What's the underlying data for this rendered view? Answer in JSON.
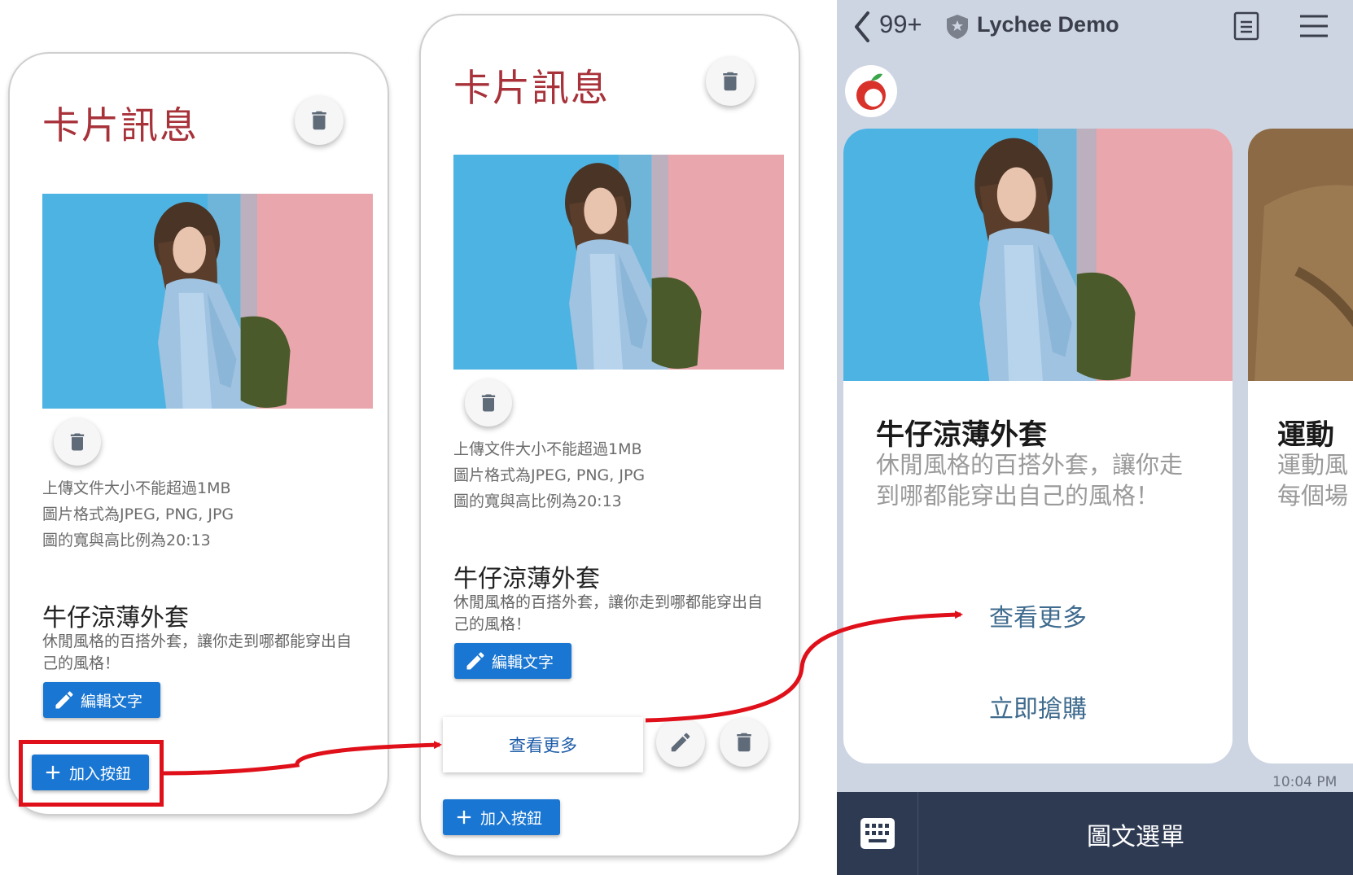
{
  "editor": {
    "card_title": "卡片訊息",
    "upload_info": [
      "上傳文件大小不能超過1MB",
      "圖片格式為JPEG, PNG, JPG",
      "圖的寬與高比例為20:13"
    ],
    "product_name": "牛仔涼薄外套",
    "product_desc": "休閒風格的百搭外套，讓你走到哪都能穿出自己的風格！",
    "edit_text_button": "編輯文字",
    "add_button": "加入按鈕",
    "action_button_label": "查看更多"
  },
  "line_preview": {
    "header": {
      "unread_count": "99+",
      "chat_name": "Lychee Demo"
    },
    "card1": {
      "title": "牛仔涼薄外套",
      "description": "休閒風格的百搭外套，讓你走到哪都能穿出自己的風格！",
      "buttons": [
        "查看更多",
        "立即搶購"
      ]
    },
    "card2": {
      "title": "運動",
      "description_lines": [
        "運動風",
        "每個場"
      ]
    },
    "timestamp": "10:04 PM",
    "rich_menu_label": "圖文選單"
  },
  "colors": {
    "title_red": "#a8323a",
    "button_blue": "#1976d2",
    "highlight_red": "#e0101a",
    "line_bar": "#2e3a52",
    "line_bg": "#cdd4e2"
  },
  "icons": [
    "trash-icon",
    "pencil-icon",
    "plus-icon",
    "back-chevron-icon",
    "shield-icon",
    "note-icon",
    "menu-icon",
    "keyboard-icon"
  ]
}
